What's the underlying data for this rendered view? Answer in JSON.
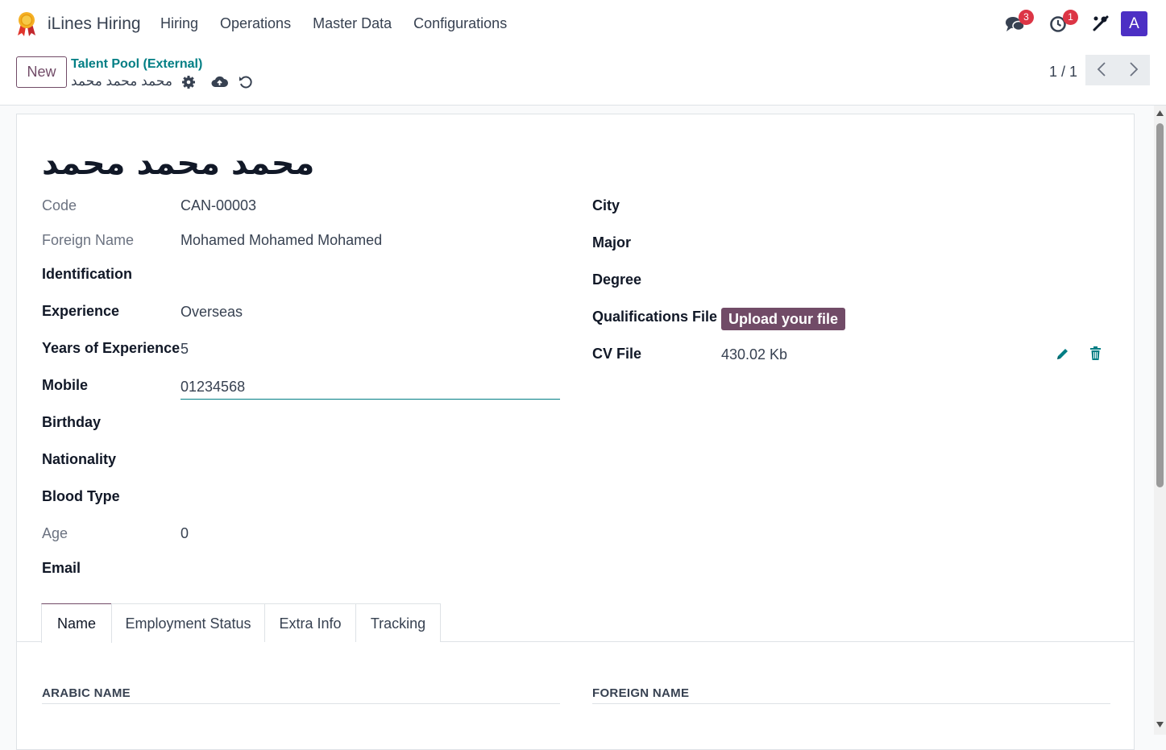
{
  "navbar": {
    "app_name": "iLines Hiring",
    "menu": [
      "Hiring",
      "Operations",
      "Master Data",
      "Configurations"
    ],
    "messages_badge": "3",
    "activity_badge": "1",
    "avatar_letter": "A"
  },
  "control_panel": {
    "new_label": "New",
    "breadcrumb": "Talent Pool (External)",
    "record_name": "محمد محمد محمد",
    "pager": "1 / 1"
  },
  "form": {
    "title": "محمد محمد محمد",
    "left": {
      "code_label": "Code",
      "code_value": "CAN-00003",
      "foreign_name_label": "Foreign Name",
      "foreign_name_value": "Mohamed Mohamed Mohamed",
      "identification_label": "Identification",
      "experience_label": "Experience",
      "experience_value": "Overseas",
      "years_label": "Years of Experience",
      "years_value": "5",
      "mobile_label": "Mobile",
      "mobile_value": "01234568",
      "birthday_label": "Birthday",
      "nationality_label": "Nationality",
      "blood_type_label": "Blood Type",
      "age_label": "Age",
      "age_value": "0",
      "email_label": "Email"
    },
    "right": {
      "city_label": "City",
      "major_label": "Major",
      "degree_label": "Degree",
      "qualifications_label": "Qualifications File",
      "upload_label": "Upload your file",
      "cv_label": "CV File",
      "cv_value": "430.02 Kb"
    }
  },
  "tabs": [
    "Name",
    "Employment Status",
    "Extra Info",
    "Tracking"
  ],
  "sections": {
    "arabic_name": "ARABIC NAME",
    "foreign_name": "FOREIGN NAME"
  },
  "colors": {
    "brand": "#714b67",
    "accent": "#017e84",
    "badge": "#dc3545",
    "avatar": "#4c2fc4"
  }
}
